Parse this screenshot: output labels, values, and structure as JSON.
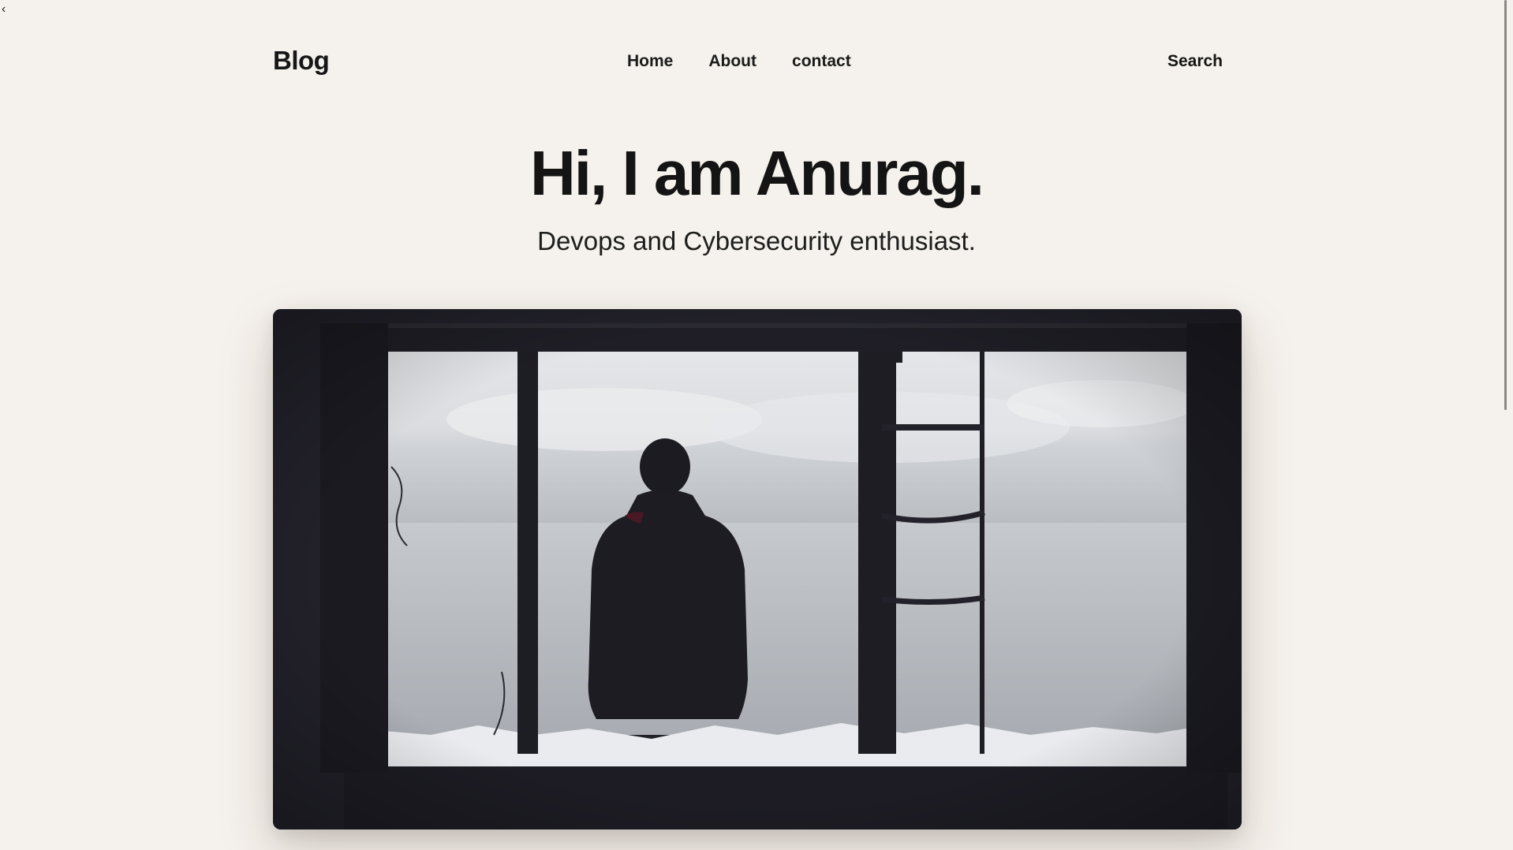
{
  "page": {
    "back_glyph": "‹"
  },
  "header": {
    "brand": "Blog",
    "nav": [
      {
        "label": "Home"
      },
      {
        "label": "About"
      },
      {
        "label": "contact"
      }
    ],
    "search_label": "Search"
  },
  "hero": {
    "title": "Hi, I am Anurag.",
    "subtitle": "Devops and Cybersecurity enthusiast.",
    "image_icon": "person-at-window-photo"
  },
  "colors": {
    "background": "#f5f1ec",
    "text": "#161616",
    "image_frame": "#22212a"
  }
}
